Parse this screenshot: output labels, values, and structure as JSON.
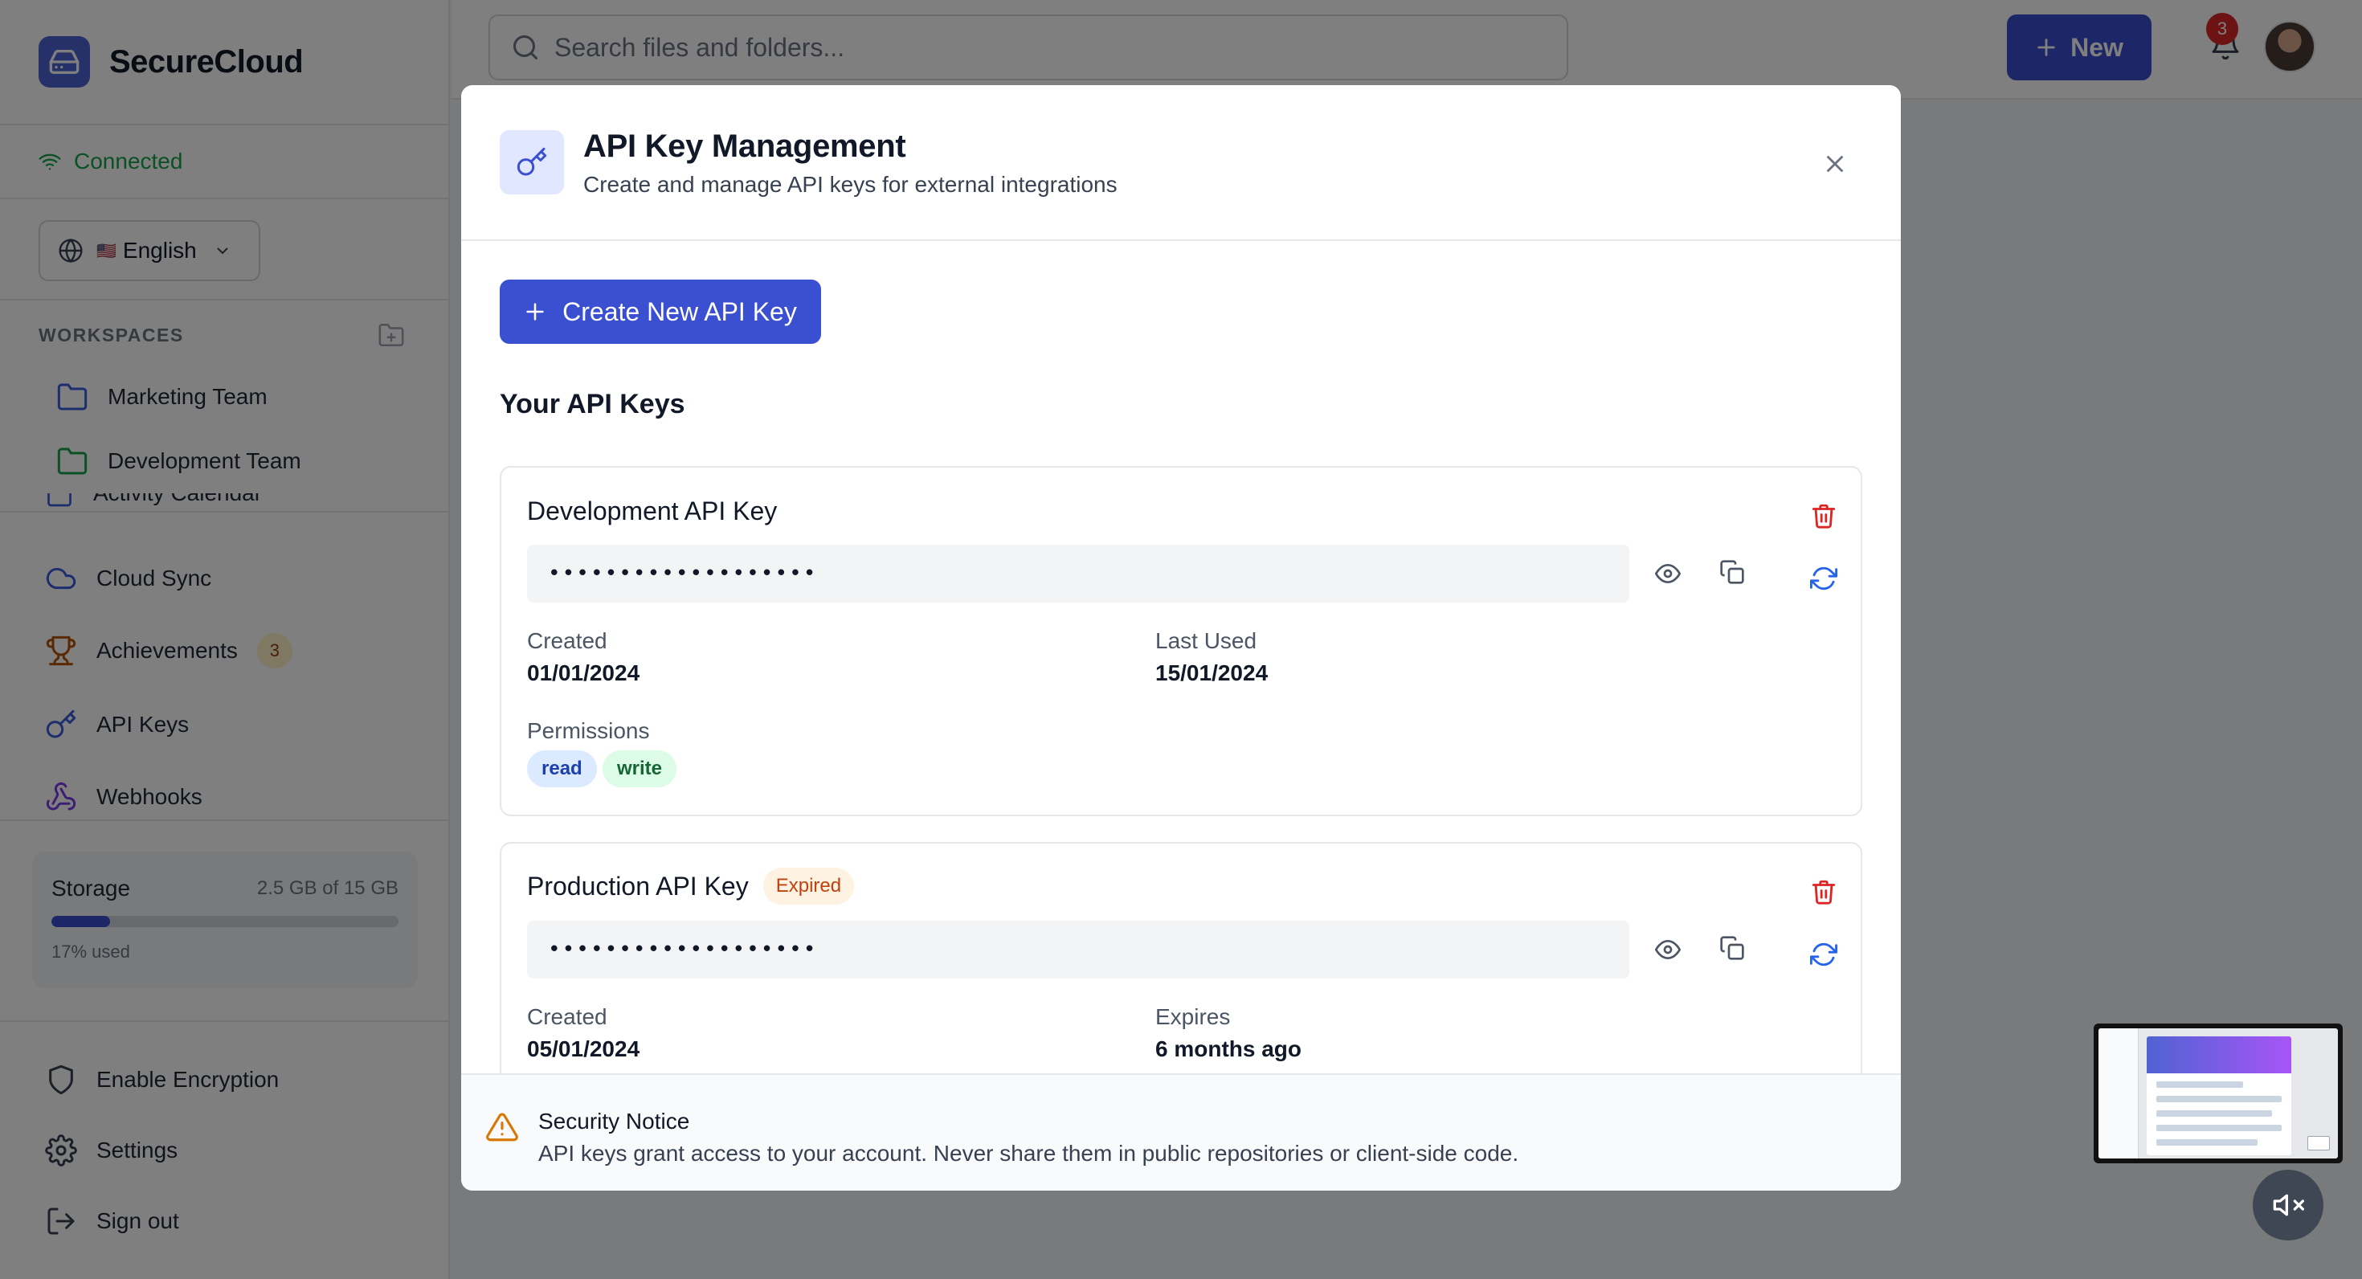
{
  "app": {
    "name": "SecureCloud"
  },
  "sidebar": {
    "connection": "Connected",
    "language": {
      "flag": "🇺🇸",
      "label": "English"
    },
    "workspaces_heading": "WORKSPACES",
    "workspaces": [
      {
        "label": "Marketing Team",
        "color": "#3b5bdb"
      },
      {
        "label": "Development Team",
        "color": "#16a34a"
      }
    ],
    "partial_item": "Activity Calendar",
    "nav": [
      {
        "label": "Cloud Sync",
        "icon": "cloud-icon"
      },
      {
        "label": "Achievements",
        "icon": "trophy-icon",
        "badge": "3"
      },
      {
        "label": "API Keys",
        "icon": "key-icon"
      },
      {
        "label": "Webhooks",
        "icon": "webhook-icon"
      }
    ],
    "storage": {
      "title": "Storage",
      "amount": "2.5 GB of 15 GB",
      "used_fraction": 0.17,
      "used_label": "17% used"
    },
    "bottom": [
      {
        "label": "Enable Encryption",
        "icon": "shield-icon"
      },
      {
        "label": "Settings",
        "icon": "gear-icon"
      },
      {
        "label": "Sign out",
        "icon": "sign-out-icon"
      }
    ]
  },
  "topbar": {
    "search_placeholder": "Search files and folders...",
    "new_label": "New",
    "notification_count": "3"
  },
  "modal": {
    "title": "API Key Management",
    "subtitle": "Create and manage API keys for external integrations",
    "create_label": "Create New API Key",
    "keys_heading": "Your API Keys",
    "keys": [
      {
        "name": "Development API Key",
        "masked": "•••••••••••••••••••",
        "created_label": "Created",
        "created": "01/01/2024",
        "second_label": "Last Used",
        "second_value": "15/01/2024",
        "permissions_label": "Permissions",
        "permissions": [
          "read",
          "write"
        ]
      },
      {
        "name": "Production API Key",
        "badge": "Expired",
        "masked": "•••••••••••••••••••",
        "created_label": "Created",
        "created": "05/01/2024",
        "second_label": "Expires",
        "second_value": "6 months ago"
      }
    ],
    "notice": {
      "title": "Security Notice",
      "text": "API keys grant access to your account. Never share them in public repositories or client-side code."
    }
  },
  "colors": {
    "primary": "#3b4fd1",
    "danger": "#dc2626",
    "success": "#16a34a",
    "warning": "#c2410c"
  }
}
